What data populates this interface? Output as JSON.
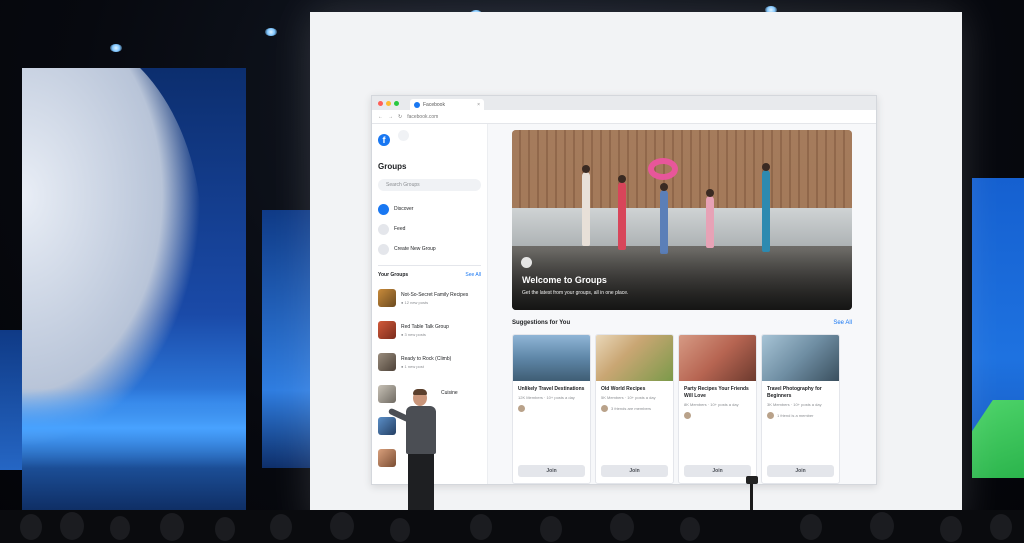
{
  "browser": {
    "tab_label": "Facebook",
    "tab_close": "×",
    "url": "facebook.com"
  },
  "sidebar": {
    "logo": "f",
    "title": "Groups",
    "search_placeholder": "Search Groups",
    "items": [
      {
        "label": "Discover",
        "icon": "compass-icon"
      },
      {
        "label": "Feed",
        "icon": "feed-icon"
      },
      {
        "label": "Create New Group",
        "icon": "plus-icon"
      }
    ],
    "your_groups": {
      "heading": "Your Groups",
      "see_all": "See All",
      "groups": [
        {
          "name": "Not-So-Secret Family Recipes",
          "sub": "● 12 new posts"
        },
        {
          "name": "Red Table Talk Group",
          "sub": "● 3 new posts"
        },
        {
          "name": "Ready to Rock (Climb)",
          "sub": "● 1 new post"
        },
        {
          "name": "Cuisine",
          "sub": ""
        },
        {
          "name": "",
          "sub": ""
        },
        {
          "name": "",
          "sub": ""
        }
      ]
    }
  },
  "hero": {
    "title": "Welcome to Groups",
    "subtitle": "Get the latest from your groups, all in one place."
  },
  "suggestions": {
    "heading": "Suggestions for You",
    "see_all": "See All",
    "cards": [
      {
        "title": "Unlikely Travel Destinations",
        "meta": "12K Members · 10+ posts a day",
        "friends": "",
        "join": "Join"
      },
      {
        "title": "Old World Recipes",
        "meta": "5K Members · 10+ posts a day",
        "friends": "3 friends are members",
        "join": "Join"
      },
      {
        "title": "Party Recipes Your Friends Will Love",
        "meta": "8K Members · 10+ posts a day",
        "friends": "",
        "join": "Join"
      },
      {
        "title": "Travel Photography for Beginners",
        "meta": "3K Members · 10+ posts a day",
        "friends": "1 friend is a member",
        "join": "Join"
      }
    ]
  },
  "colors": {
    "brand": "#1877f2",
    "stage_blue": "#1a4aa8",
    "stage_green": "#2bb44c"
  }
}
